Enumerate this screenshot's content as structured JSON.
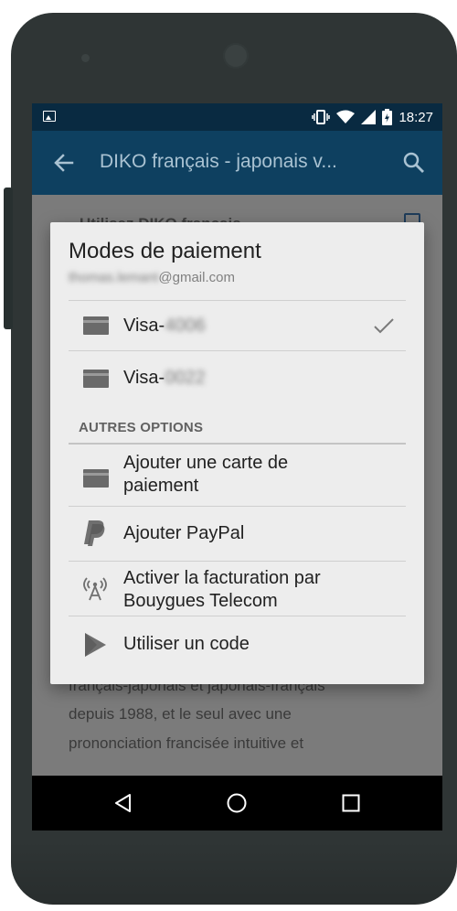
{
  "status_bar": {
    "time": "18:27",
    "icons": [
      "image-icon",
      "vibrate-icon",
      "wifi-icon",
      "signal-icon",
      "battery-charging-icon"
    ]
  },
  "action_bar": {
    "title": "DIKO français - japonais v...",
    "icons": [
      "back-arrow-icon",
      "search-icon"
    ]
  },
  "background": {
    "heading_partial": "Utilisez DIKO français",
    "lines": [
      "français-japonais et japonais-français",
      "depuis 1988, et le seul avec une",
      "prononciation francisée intuitive et"
    ]
  },
  "dialog": {
    "title": "Modes de paiement",
    "email_blurred": "thomas.lemant",
    "email_domain": "@gmail.com",
    "cards": [
      {
        "prefix": "Visa-",
        "masked": "4006",
        "selected": true
      },
      {
        "prefix": "Visa-",
        "masked": "0022",
        "selected": false
      }
    ],
    "other_options_heading": "AUTRES OPTIONS",
    "options": [
      {
        "icon": "credit-card-icon",
        "label_line1": "Ajouter une carte de",
        "label_line2": "paiement"
      },
      {
        "icon": "paypal-icon",
        "label_line1": "Ajouter PayPal",
        "label_line2": ""
      },
      {
        "icon": "carrier-billing-icon",
        "label_line1": "Activer la facturation par",
        "label_line2": "Bouygues Telecom"
      },
      {
        "icon": "play-store-icon",
        "label_line1": "Utiliser un code",
        "label_line2": ""
      }
    ]
  },
  "nav_bar": {
    "buttons": [
      "back-triangle-icon",
      "home-circle-icon",
      "recents-square-icon"
    ]
  },
  "colors": {
    "status_bar": "#092a41",
    "action_bar": "#0e4060",
    "dialog_bg": "#ededed",
    "phone_body": "#2f3535"
  }
}
